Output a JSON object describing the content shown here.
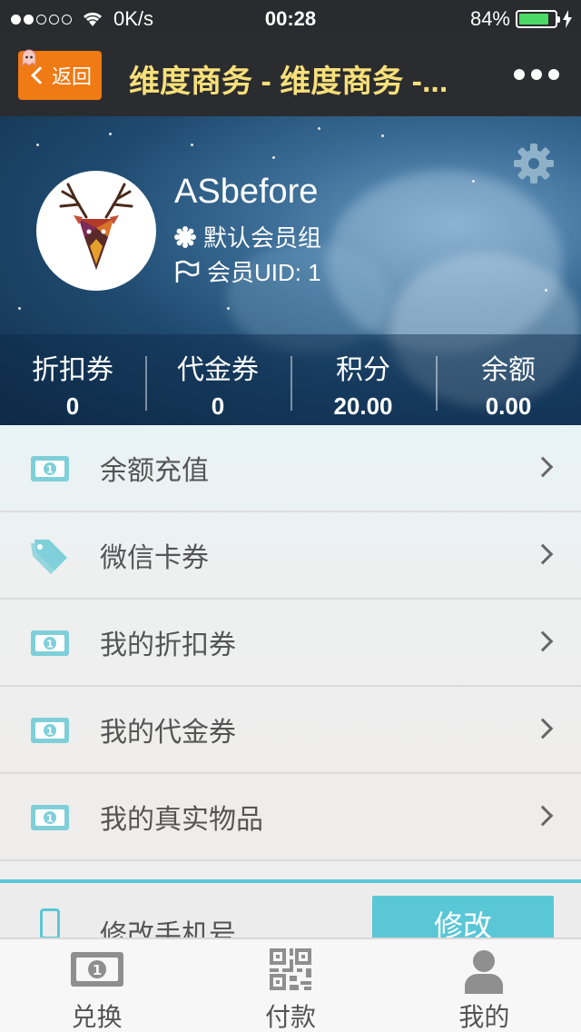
{
  "status_bar": {
    "carrier_speed": "0K/s",
    "time": "00:28",
    "battery": "84%",
    "battery_level": 0.84
  },
  "nav": {
    "back_label": "返回",
    "title": "维度商务 - 维度商务 -..."
  },
  "profile": {
    "username": "ASbefore",
    "group": "默认会员组",
    "uid": "会员UID: 1",
    "stats": [
      {
        "label": "折扣券",
        "value": "0"
      },
      {
        "label": "代金券",
        "value": "0"
      },
      {
        "label": "积分",
        "value": "20.00"
      },
      {
        "label": "余额",
        "value": "0.00"
      }
    ]
  },
  "menu": [
    {
      "label": "余额充值",
      "icon": "money-icon"
    },
    {
      "label": "微信卡券",
      "icon": "tag-icon"
    },
    {
      "label": "我的折扣券",
      "icon": "money-icon"
    },
    {
      "label": "我的代金券",
      "icon": "money-icon"
    },
    {
      "label": "我的真实物品",
      "icon": "money-icon"
    }
  ],
  "phone": {
    "label": "修改手机号",
    "button": "修改"
  },
  "tabs": [
    {
      "label": "兑换",
      "icon": "money-icon"
    },
    {
      "label": "付款",
      "icon": "qrcode-icon"
    },
    {
      "label": "我的",
      "icon": "user-icon"
    }
  ],
  "colors": {
    "accent": "#5ac7d6",
    "back_button": "#f07a14",
    "title": "#f8e07a"
  }
}
